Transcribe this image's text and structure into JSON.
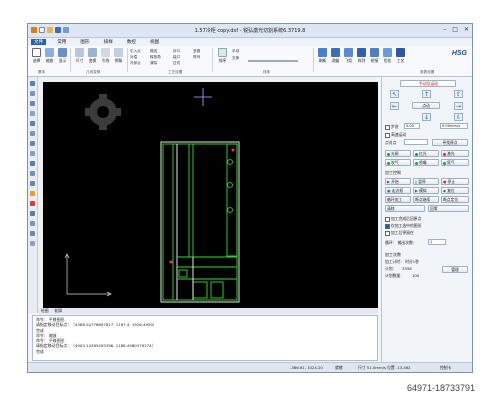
{
  "window": {
    "title": "1.57冷柜 copy.dxf - 锐弘激光切割系统6.3719.8"
  },
  "menu": {
    "tabs": [
      "文件",
      "常用",
      "图形",
      "排样",
      "数控",
      "视图"
    ],
    "active": "常用"
  },
  "ribbon": {
    "groups": [
      {
        "label": "基本",
        "buttons": [
          "选择",
          "缩放",
          "显示"
        ]
      },
      {
        "label": "几何变换",
        "buttons": [
          "尺寸",
          "变换",
          "引线",
          "倒角"
        ]
      },
      {
        "label": "工艺设置",
        "buttons": [
          "引入点",
          "补偿",
          "冷却点",
          "微连",
          "释放角",
          "清除",
          "封口",
          "缺口",
          "过切",
          "多圈",
          "阵列"
        ]
      },
      {
        "label": "排序",
        "buttons": [
          "排序",
          "手动",
          "交换"
        ]
      },
      {
        "label": "",
        "buttons": [
          "刷新",
          "测量",
          "飞切",
          "阵列",
          "桥接",
          "优化",
          "工艺"
        ]
      },
      {
        "label": "参数设置",
        "buttons": []
      }
    ],
    "brand": "HSG"
  },
  "canvas": {
    "origin_axes": "X Y"
  },
  "bottom_tabs": [
    "绘图",
    "轮廓"
  ],
  "log": {
    "lines": [
      "命令：  平移图形",
      "请指定移动目标点：（4388.20776897817,  1187.4,  1926.4950）",
      "完成",
      "命令：  缩放",
      "命令：  平移图形",
      "请指定移动目标点：（4903.14385495396,  1188.4980379274）",
      "完成"
    ]
  },
  "status": {
    "coords": "-386.61,  1024.20",
    "mode": "就绪",
    "speed": "尺寸 51.0mm/s  位置 -13.462",
    "extra": "控制卡"
  },
  "panel": {
    "move_title": "手动及运动",
    "step_label": "点动",
    "step_check": "步进",
    "step_value": "5.00",
    "speed_value": "9.00mm/s",
    "continuous_label": "高速运动",
    "laser_point_label": "点对点",
    "return_label": "寻找原点",
    "buttons": [
      "光闸",
      "红光",
      "激光",
      "吹气",
      "喷嘴",
      "氮气"
    ],
    "process_title": "加工控制",
    "process_buttons": [
      "开始",
      "暂停",
      "停止",
      "走边框",
      "模拟",
      "复位",
      "循环加工",
      "断点继续",
      "断点定位",
      "清除",
      "回零"
    ],
    "process_checks": [
      "加工完成后回原点",
      "仅加工选中的图形",
      "加工后停留在"
    ],
    "count_label": "加工计数",
    "count_title": "加工次数",
    "loop_label": "循环：  输出次数：",
    "loop_value": "1",
    "total_time": "加工计时：  时分1秒",
    "plan_label": "计划：",
    "plan_value": "3358",
    "done_label": "计划数量：",
    "done_value": "100",
    "manage_button": "管理",
    "check_label": "检查边框"
  },
  "watermark": "64971-18733791",
  "colors": {
    "accent": "#2d5fa8",
    "canvas_bg": "#000000",
    "part_outline": "#33dd33",
    "part_edge": "#ffffff",
    "highlight": "#ff3030",
    "grid_dot": "#3a3a3a"
  }
}
